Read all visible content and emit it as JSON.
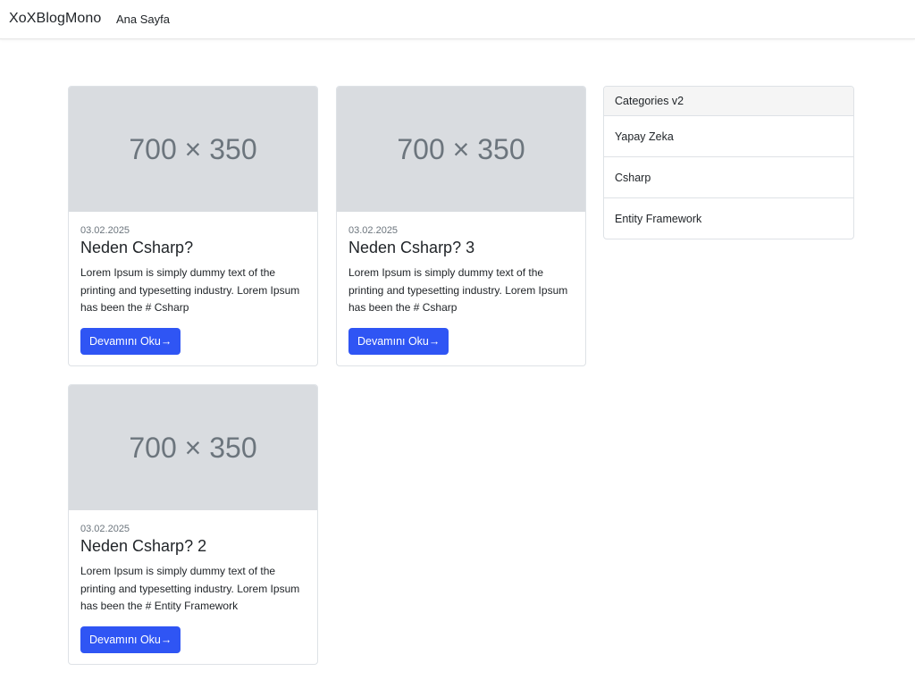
{
  "navbar": {
    "brand": "XoXBlogMono",
    "links": [
      {
        "label": "Ana Sayfa"
      }
    ]
  },
  "posts": [
    {
      "image_placeholder": "700 × 350",
      "date": "03.02.2025",
      "title": "Neden Csharp?",
      "text": "Lorem Ipsum is simply dummy text of the printing and typesetting industry. Lorem Ipsum has been the # Csharp",
      "button_label": "Devamını Oku→"
    },
    {
      "image_placeholder": "700 × 350",
      "date": "03.02.2025",
      "title": "Neden Csharp? 3",
      "text": "Lorem Ipsum is simply dummy text of the printing and typesetting industry. Lorem Ipsum has been the # Csharp",
      "button_label": "Devamını Oku→"
    },
    {
      "image_placeholder": "700 × 350",
      "date": "03.02.2025",
      "title": "Neden Csharp? 2",
      "text": "Lorem Ipsum is simply dummy text of the printing and typesetting industry. Lorem Ipsum has been the # Entity Framework",
      "button_label": "Devamını Oku→"
    }
  ],
  "categories": {
    "header": "Categories v2",
    "items": [
      {
        "label": "Yapay Zeka"
      },
      {
        "label": "Csharp"
      },
      {
        "label": "Entity Framework"
      }
    ]
  },
  "colors": {
    "accent": "#2f55f4",
    "placeholder_bg": "#d9dce0",
    "border": "#dee2e6"
  }
}
